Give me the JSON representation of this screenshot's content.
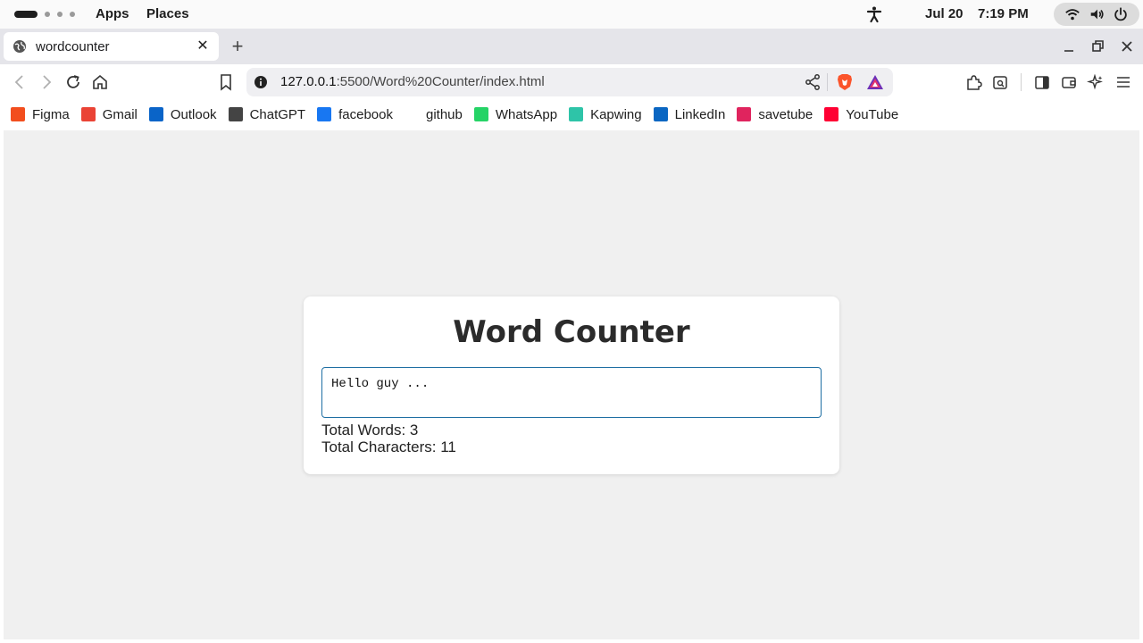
{
  "topbar": {
    "menu": [
      "Apps",
      "Places"
    ],
    "date": "Jul 20",
    "time": "7:19 PM"
  },
  "browser": {
    "tab_title": "wordcounter",
    "url_host": "127.0.0.1",
    "url_path": ":5500/Word%20Counter/index.html"
  },
  "bookmarks": [
    {
      "label": "Figma",
      "icon": "figma-icon",
      "color": "#f24e1e"
    },
    {
      "label": "Gmail",
      "icon": "gmail-icon",
      "color": "#ea4335"
    },
    {
      "label": "Outlook",
      "icon": "outlook-icon",
      "color": "#0a64c8"
    },
    {
      "label": "ChatGPT",
      "icon": "chatgpt-icon",
      "color": "#444444"
    },
    {
      "label": "facebook",
      "icon": "facebook-icon",
      "color": "#1877f2"
    },
    {
      "label": "github",
      "icon": "github-icon",
      "color": "#ffffff"
    },
    {
      "label": "WhatsApp",
      "icon": "whatsapp-icon",
      "color": "#25d366"
    },
    {
      "label": "Kapwing",
      "icon": "kapwing-icon",
      "color": "#2ec4a8"
    },
    {
      "label": "LinkedIn",
      "icon": "linkedin-icon",
      "color": "#0a66c2"
    },
    {
      "label": "savetube",
      "icon": "download-icon",
      "color": "#e0245e"
    },
    {
      "label": "YouTube",
      "icon": "youtube-icon",
      "color": "#ff0033"
    }
  ],
  "app": {
    "title": "Word Counter",
    "textarea_value": "Hello guy ...",
    "total_words_label": "Total Words: 3",
    "total_chars_label": "Total Characters: 11"
  },
  "colors": {
    "accent": "#1f6fa3",
    "page_bg": "#f0f0f0"
  }
}
